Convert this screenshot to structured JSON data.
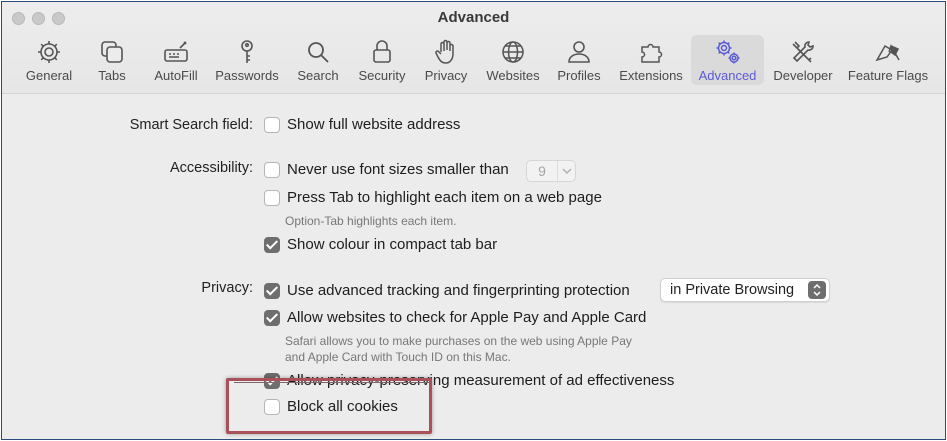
{
  "window": {
    "title": "Advanced"
  },
  "toolbar": {
    "tabs": [
      {
        "label": "General",
        "icon": "gear-icon"
      },
      {
        "label": "Tabs",
        "icon": "tabs-icon"
      },
      {
        "label": "AutoFill",
        "icon": "autofill-icon"
      },
      {
        "label": "Passwords",
        "icon": "key-icon"
      },
      {
        "label": "Search",
        "icon": "search-icon"
      },
      {
        "label": "Security",
        "icon": "lock-icon"
      },
      {
        "label": "Privacy",
        "icon": "hand-icon"
      },
      {
        "label": "Websites",
        "icon": "globe-icon"
      },
      {
        "label": "Profiles",
        "icon": "person-icon"
      },
      {
        "label": "Extensions",
        "icon": "puzzle-icon"
      },
      {
        "label": "Advanced",
        "icon": "gears-icon",
        "active": true
      },
      {
        "label": "Developer",
        "icon": "tools-icon"
      },
      {
        "label": "Feature Flags",
        "icon": "flags-icon"
      }
    ],
    "accent_color": "#5b5ad6"
  },
  "smart_search": {
    "label": "Smart Search field:",
    "show_full_address": {
      "label": "Show full website address",
      "checked": false
    }
  },
  "accessibility": {
    "label": "Accessibility:",
    "min_font": {
      "label": "Never use font sizes smaller than",
      "checked": false,
      "value": "9"
    },
    "tab_highlight": {
      "label": "Press Tab to highlight each item on a web page",
      "checked": false,
      "note": "Option-Tab highlights each item."
    },
    "compact_colour": {
      "label": "Show colour in compact tab bar",
      "checked": true
    }
  },
  "privacy": {
    "label": "Privacy:",
    "advanced_tracking": {
      "label": "Use advanced tracking and fingerprinting protection",
      "checked": true,
      "scope": "in Private Browsing"
    },
    "apple_pay": {
      "label": "Allow websites to check for Apple Pay and Apple Card",
      "checked": true,
      "note_line1": "Safari allows you to make purchases on the web using Apple Pay",
      "note_line2": "and Apple Card with Touch ID on this Mac."
    },
    "ad_measurement": {
      "label": "Allow privacy-preserving measurement of ad effectiveness",
      "checked": true
    },
    "block_cookies": {
      "label": "Block all cookies",
      "checked": false
    }
  }
}
